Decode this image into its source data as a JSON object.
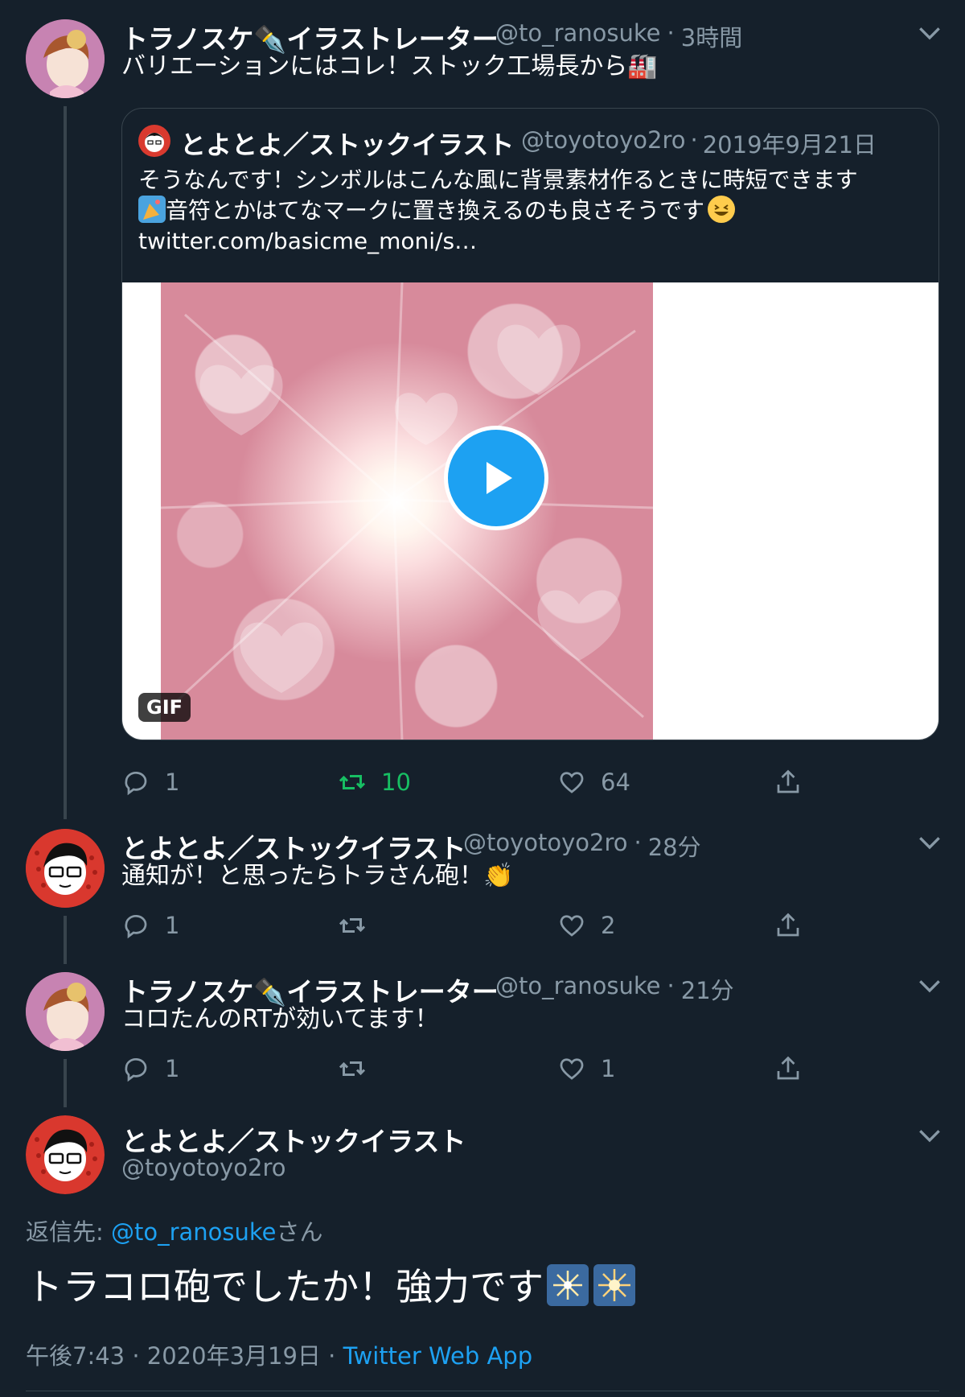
{
  "tweets": [
    {
      "name": "トラノスケ✒️イラストレーター",
      "handle": "@to_ranosuke",
      "time": "3時間",
      "text": "バリエーションにはコレ！ストック工場長から🏭",
      "quote": {
        "name": "とよとよ／ストックイラスト",
        "handle": "@toyotoyo2ro",
        "date": "2019年9月21日",
        "line1": "そうなんです！シンボルはこんな風に背景素材作るときに時短できます",
        "line2": "音符とかはてなマークに置き換えるのも良さそうです",
        "line3": "twitter.com/basicme_moni/s…",
        "media_badge": "GIF"
      },
      "replies": "1",
      "retweets": "10",
      "likes": "64"
    },
    {
      "name": "とよとよ／ストックイラスト",
      "handle": "@toyotoyo2ro",
      "time": "28分",
      "text": "通知が！と思ったらトラさん砲！👏",
      "replies": "1",
      "retweets": "",
      "likes": "2"
    },
    {
      "name": "トラノスケ✒️イラストレーター",
      "handle": "@to_ranosuke",
      "time": "21分",
      "text": "コロたんのRTが効いてます！",
      "replies": "1",
      "retweets": "",
      "likes": "1"
    }
  ],
  "main": {
    "name": "とよとよ／ストックイラスト",
    "handle": "@toyotoyo2ro",
    "reply_prefix": "返信先: ",
    "reply_to": "@to_ranosuke",
    "reply_suffix": "さん",
    "text": "トラコロ砲でしたか！強力です",
    "timestamp": "午後7:43 · 2020年3月19日 · ",
    "source": "Twitter Web App"
  },
  "colors": {
    "background": "#15202b",
    "secondary_text": "#8899a6",
    "link": "#1da1f2",
    "retweet_active": "#17bf63",
    "thread_line": "#38444d"
  }
}
